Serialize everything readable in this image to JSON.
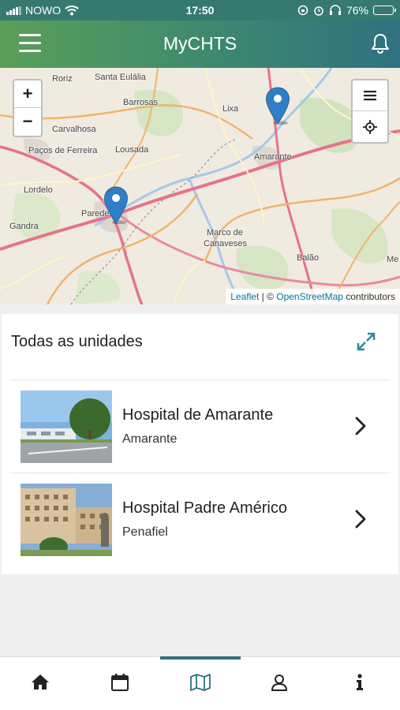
{
  "status_bar": {
    "carrier": "NOWO",
    "time": "17:50",
    "battery": "76%",
    "battery_level": 0.76
  },
  "header": {
    "menu_icon": "hamburger-menu-icon",
    "title": "MyCHTS",
    "bell_icon": "bell-icon"
  },
  "map": {
    "zoom_in": "+",
    "zoom_out": "−",
    "place_names": [
      "Roriz",
      "Santa Eulália",
      "Barrosas",
      "Carvalhosa",
      "Paços de Ferreira",
      "Lousada",
      "Lixa",
      "Amarante",
      "Lordelo",
      "Paredes",
      "Gandra",
      "Marco de",
      "Canaveses",
      "Balão",
      "Me"
    ],
    "attribution": {
      "leaflet": "Leaflet",
      "separator": " | © ",
      "osm": "OpenStreetMap",
      "contributors": " contributors"
    },
    "marker_color": "#2f7fc6"
  },
  "units_card": {
    "title": "Todas as unidades",
    "expand_icon": "expand-arrows-icon",
    "units": [
      {
        "name": "Hospital de Amarante",
        "city": "Amarante"
      },
      {
        "name": "Hospital Padre Américo",
        "city": "Penafiel"
      }
    ]
  },
  "bottom_nav": {
    "items": [
      "home-icon",
      "calendar-icon",
      "map-icon",
      "user-icon",
      "info-icon"
    ],
    "active": "map-icon",
    "accent": "#2f7180"
  }
}
